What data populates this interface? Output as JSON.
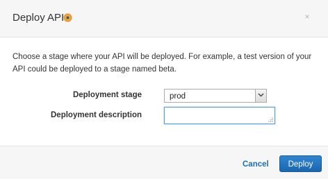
{
  "dialog": {
    "title": "Deploy API",
    "help_icon": "info-help-icon",
    "close_symbol": "×"
  },
  "body": {
    "description": "Choose a stage where your API will be deployed. For example, a test version of your API could be deployed to a stage named beta."
  },
  "form": {
    "stage_label": "Deployment stage",
    "stage_value": "prod",
    "description_label": "Deployment description",
    "description_value": ""
  },
  "footer": {
    "cancel_label": "Cancel",
    "deploy_label": "Deploy"
  },
  "colors": {
    "link": "#1f6fb2",
    "primary_button": "#1a66b0",
    "focus_border": "#5b9dd9"
  }
}
